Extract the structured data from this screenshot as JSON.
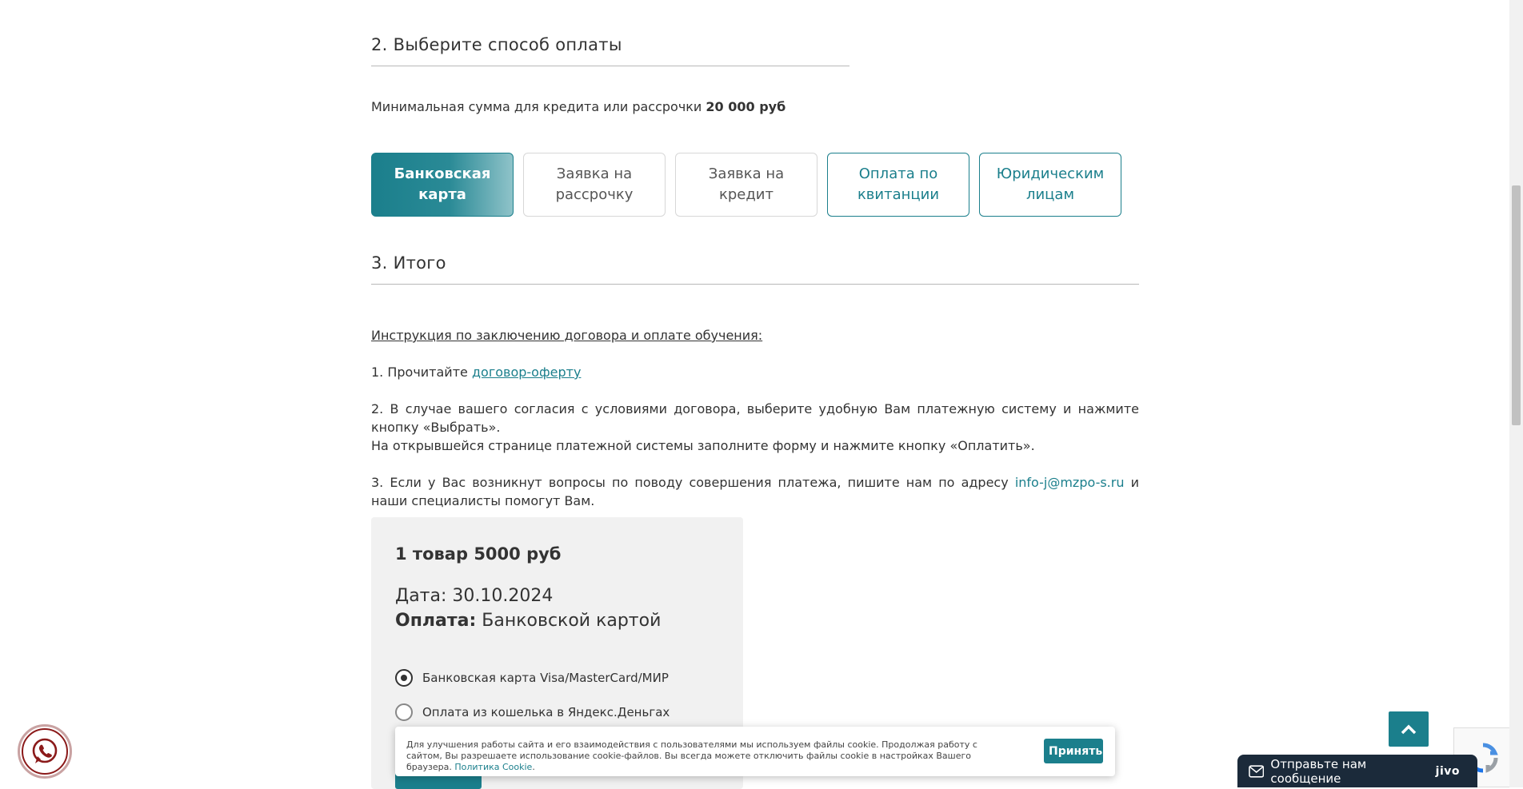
{
  "section_payment": {
    "title": "2. Выберите способ оплаты"
  },
  "min_sum": {
    "text": "Минимальная сумма для кредита или рассрочки",
    "amount": "20 000 руб"
  },
  "payment_tabs": [
    {
      "label": "Банковская карта",
      "state": "active"
    },
    {
      "label": "Заявка на рассрочку",
      "state": "inactive"
    },
    {
      "label": "Заявка на кредит",
      "state": "inactive"
    },
    {
      "label": "Оплата по квитанции",
      "state": "inactive"
    },
    {
      "label": "Юридическим лицам",
      "state": "inactive"
    }
  ],
  "section_total": {
    "title": "3. Итого"
  },
  "instructions": {
    "heading": "Инструкция по заключению договора и оплате обучения:",
    "step1_prefix": "1. Прочитайте",
    "step1_link": "договор-оферту",
    "step2_line1": "2. В случае вашего согласия с условиями договора, выберите удобную Вам платежную систему и нажмите кнопку «Выбрать».",
    "step2_line2": "На открывшейся странице платежной системы заполните форму и нажмите кнопку «Оплатить».",
    "step3_prefix": "3. Если у Вас возникнут вопросы по поводу совершения платежа, пишите нам по адресу",
    "step3_email": "info-j@mzpo-s.ru",
    "step3_suffix": "и наши специалисты помогут Вам."
  },
  "summary": {
    "title": "1 товар 5000 руб",
    "date_label": "Дата:",
    "date_value": "30.10.2024",
    "payment_label": "Оплата:",
    "payment_value": "Банковской картой",
    "options": [
      {
        "label": "Банковская карта Visa/MasterCard/МИР",
        "selected": true
      },
      {
        "label": "Оплата из кошелька в Яндекс.Деньгах",
        "selected": false
      }
    ]
  },
  "cookie_banner": {
    "text": "Для улучшения работы сайта и его взаимодействия с пользователями мы используем файлы cookie. Продолжая работу с сайтом, Вы разрешаете использование cookie-файлов. Вы всегда можете отключить файлы cookie в настройках Вашего браузера.",
    "policy_link": "Политика Cookie",
    "policy_suffix": ".",
    "accept_label": "Принять"
  },
  "chat_widget": {
    "message": "Отправьте нам сообщение",
    "brand": "jivo"
  },
  "colors": {
    "accent": "#1b7f8c",
    "card_bg": "#f1f1f1",
    "chat_bg": "#1b2a3a"
  },
  "icons": [
    "whatsapp-icon",
    "arrow-up-icon",
    "recaptcha-icon",
    "mail-icon"
  ]
}
